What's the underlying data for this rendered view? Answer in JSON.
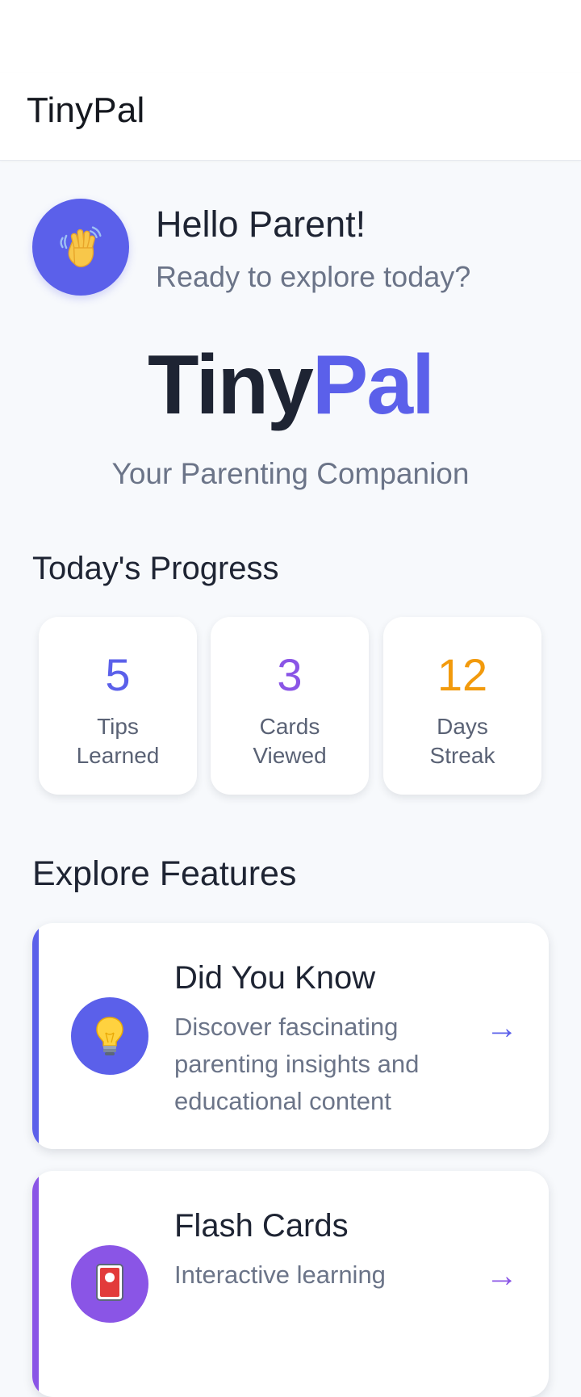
{
  "app_bar": {
    "title": "TinyPal"
  },
  "greeting": {
    "title": "Hello Parent!",
    "subtitle": "Ready to explore today?",
    "icon": "waving-hand-icon"
  },
  "hero": {
    "logo_part1": "Tiny",
    "logo_part2": "Pal",
    "tagline": "Your Parenting Companion"
  },
  "progress": {
    "title": "Today's Progress",
    "stats": [
      {
        "value": "5",
        "line1": "Tips",
        "line2": "Learned",
        "color": "#5b60ea"
      },
      {
        "value": "3",
        "line1": "Cards",
        "line2": "Viewed",
        "color": "#8a55e6"
      },
      {
        "value": "12",
        "line1": "Days",
        "line2": "Streak",
        "color": "#f29a0c"
      }
    ]
  },
  "explore": {
    "title": "Explore Features",
    "features": [
      {
        "title": "Did You Know",
        "description": "Discover fascinating parenting insights and educational content",
        "arrow": "→",
        "icon": "light-bulb-icon",
        "color": "#5b60ea"
      },
      {
        "title": "Flash Cards",
        "description": "Interactive learning",
        "arrow": "→",
        "icon": "flash-card-icon",
        "color": "#8a55e6"
      }
    ]
  },
  "colors": {
    "primary": "#5b60ea",
    "secondary": "#8a55e6",
    "accent": "#f29a0c",
    "text": "#1e2433",
    "muted": "#6b7488",
    "background": "#f7f9fc"
  }
}
